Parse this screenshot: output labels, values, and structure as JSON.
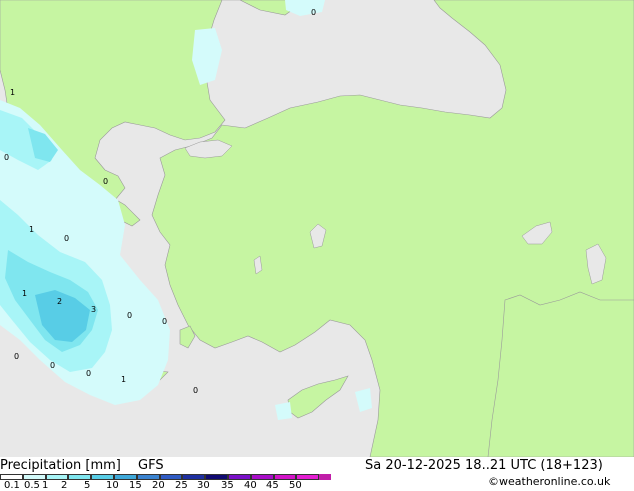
{
  "product": {
    "title": "Precipitation [mm]",
    "model": "GFS",
    "datetime": "Sa 20-12-2025 18..21 UTC (18+123)",
    "credit": "©weatheronline.co.uk"
  },
  "legend": {
    "ticks": [
      "0.1",
      "0.5",
      "1",
      "2",
      "5",
      "10",
      "15",
      "20",
      "25",
      "30",
      "35",
      "40",
      "45",
      "50"
    ],
    "colors": [
      "#ffffff",
      "#d4fbfb",
      "#a8f5f7",
      "#7fe6ef",
      "#58cde6",
      "#3fa9da",
      "#3a83d0",
      "#2f5bc4",
      "#1e2fa0",
      "#100a72",
      "#7a10c8",
      "#a80ec8",
      "#d214c8",
      "#e41ed2",
      "#c01ea8"
    ]
  },
  "colors": {
    "land": "#c6f5a2",
    "sea": "#e8e8e8",
    "precip_light": "#d4fbfb",
    "precip_mid": "#a8f5f7",
    "precip_heavy": "#7fe6ef",
    "precip_max": "#58cde6"
  },
  "map_labels": [
    "1",
    "0",
    "0",
    "1",
    "0",
    "1",
    "2",
    "3",
    "0",
    "0",
    "0",
    "0",
    "1",
    "0",
    "0"
  ]
}
